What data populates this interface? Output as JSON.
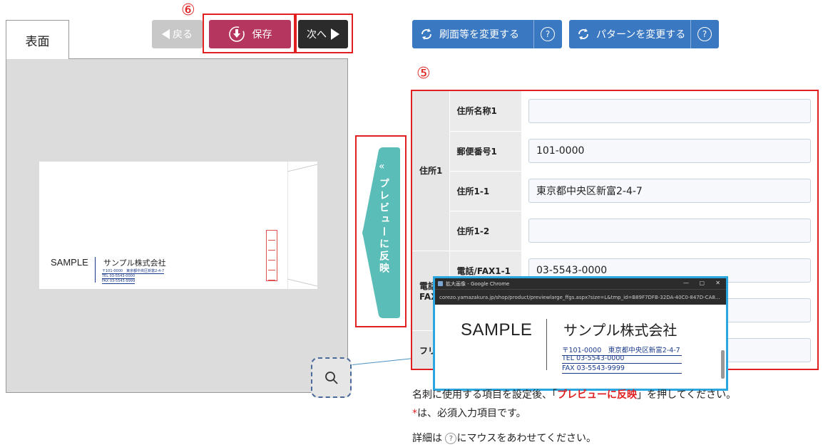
{
  "tabs": {
    "front": "表面"
  },
  "toolbar": {
    "back_label": "戻る",
    "save_label": "保存",
    "next_label": "次へ",
    "marker_save": "⑥",
    "marker_form": "⑤",
    "change_paper_label": "刷面等を変更する",
    "change_pattern_label": "パターンを変更する",
    "help_glyph": "?"
  },
  "reflect": {
    "label": "プレビューに反映",
    "chevron": "«"
  },
  "envelope": {
    "sample": "SAMPLE",
    "company": "サンプル株式会社",
    "address": "〒101-0000　東京都中央区新富2-4-7",
    "tel": "TEL 03-5543-0000",
    "fax": "FAX 03-5543-9999"
  },
  "form": {
    "group_address": "住所1",
    "group_phone": "電話",
    "group_phone_2": "FAX",
    "group_furi": "フリ",
    "rows": [
      {
        "label": "住所名称1",
        "value": ""
      },
      {
        "label": "郵便番号1",
        "value": "101-0000"
      },
      {
        "label": "住所1-1",
        "value": "東京都中央区新富2-4-7"
      },
      {
        "label": "住所1-2",
        "value": ""
      },
      {
        "label": "電話/FAX1-1",
        "value": "03-5543-0000"
      }
    ]
  },
  "popup": {
    "title": "拡大画像 - Google Chrome",
    "url": "corezo.yamazakura.jp/shop/product/previewlarge_ffgs.aspx?size=L&tmp_id=B89F7DFB-32DA-40C0-847D-CA8...",
    "sample": "SAMPLE",
    "company": "サンプル株式会社",
    "address": "〒101-0000　東京都中央区新富2-4-7",
    "tel": "TEL 03-5543-0000",
    "fax": "FAX 03-5543-9999"
  },
  "instructions": {
    "line1_a": "名刺に使用する項目を設定後、「",
    "line1_b": "プレビューに反映",
    "line1_c": "」を押してください。",
    "line2_mark": "*",
    "line2_text": "は、必須入力項目です。",
    "line3_a": "詳細は",
    "line3_b": "にマウスをあわせてください。"
  },
  "colors": {
    "save_button": "#b5365e",
    "next_button": "#2b2b2b",
    "blue_button": "#3a78c2",
    "reflect_tab": "#5bbdb8",
    "highlight": "#e02020",
    "popup_border": "#2aa6e0"
  }
}
